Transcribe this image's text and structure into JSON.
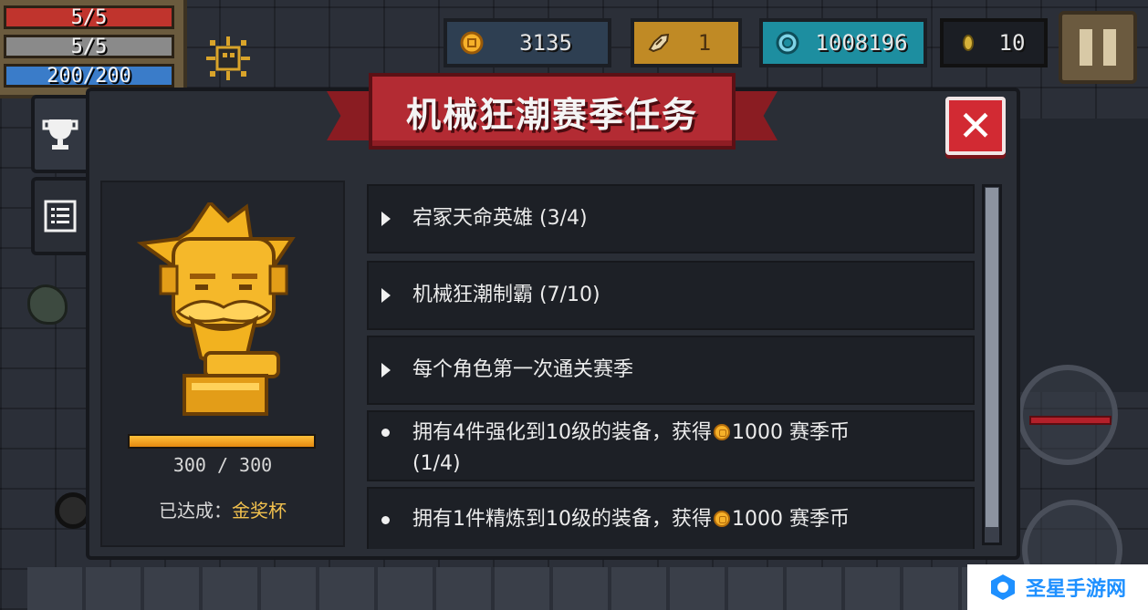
{
  "hud": {
    "hp": "5/5",
    "armor": "5/5",
    "energy": "200/200"
  },
  "currencies": {
    "coins": "3135",
    "fish": "1",
    "gems": "1008196",
    "seeds": "10"
  },
  "panel": {
    "title": "机械狂潮赛季任务",
    "progress_text": "300 / 300",
    "progress_value": 1.0,
    "achieved_label": "已达成：",
    "achieved_value": "金奖杯"
  },
  "quests": [
    {
      "type": "expandable",
      "text": "宕冢天命英雄 (3/4)"
    },
    {
      "type": "expandable",
      "text": "机械狂潮制霸 (7/10)"
    },
    {
      "type": "expandable",
      "text": "每个角色第一次通关赛季"
    },
    {
      "type": "task",
      "text_before": "拥有4件强化到10级的装备，获得",
      "text_after": "1000 赛季币",
      "progress": "(1/4)"
    },
    {
      "type": "task",
      "text_before": "拥有1件精炼到10级的装备，获得",
      "text_after": "1000 赛季币"
    }
  ],
  "watermark": {
    "text": "圣星手游网"
  },
  "colors": {
    "title_red": "#b32b33",
    "close_red": "#d22a33",
    "gold": "#f2c14e",
    "gem_teal": "#1d8ea0",
    "panel_bg": "#2a2e36"
  },
  "icons": [
    "trophy-icon",
    "list-icon",
    "coin-icon",
    "fish-icon",
    "gem-icon",
    "seed-icon",
    "pause-icon",
    "close-icon"
  ]
}
